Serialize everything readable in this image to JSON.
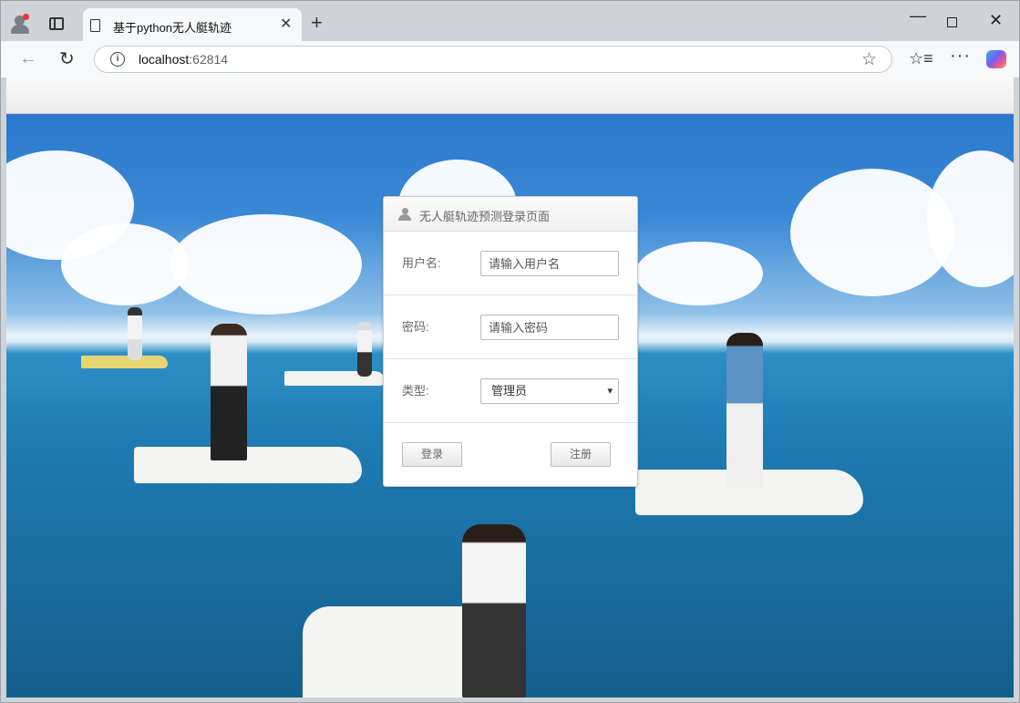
{
  "browser": {
    "tab_title": "基于python无人艇轨迹",
    "url_host": "localhost",
    "url_port": ":62814"
  },
  "login": {
    "title": "无人艇轨迹预测登录页面",
    "username_label": "用户名:",
    "username_placeholder": "请输入用户名",
    "password_label": "密码:",
    "password_placeholder": "请输入密码",
    "type_label": "类型:",
    "type_selected": "管理员",
    "login_button": "登录",
    "register_button": "注册"
  },
  "colors": {
    "sky": "#2a78cc",
    "sea": "#1f7cb4"
  }
}
